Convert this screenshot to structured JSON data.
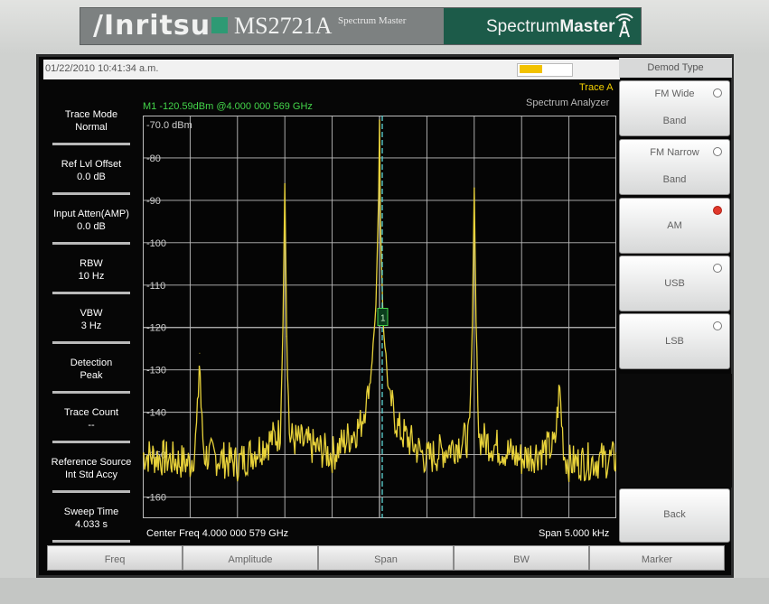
{
  "brand": {
    "logo": "/Inritsu",
    "model": "MS2721A",
    "sub": "Spectrum Master",
    "right_regular": "Spectrum",
    "right_bold": "Master"
  },
  "status": {
    "timestamp": "01/22/2010 10:41:34 a.m.",
    "battery_level": 0.45,
    "battery_color": "#f2c200"
  },
  "left_params": [
    {
      "label": "Trace Mode",
      "value": "Normal"
    },
    {
      "label": "Ref Lvl Offset",
      "value": "0.0 dB"
    },
    {
      "label": "Input Atten(AMP)",
      "value": "0.0 dB"
    },
    {
      "label": "RBW",
      "value": "10 Hz"
    },
    {
      "label": "VBW",
      "value": "3 Hz"
    },
    {
      "label": "Detection",
      "value": "Peak"
    },
    {
      "label": "Trace Count",
      "value": "--"
    },
    {
      "label": "Reference Source",
      "value": "Int Std Accy"
    },
    {
      "label": "Sweep Time",
      "value": "4.033 s"
    }
  ],
  "header": {
    "trace": "Trace A",
    "mode": "Spectrum Analyzer",
    "marker_readout": "M1 -120.59dBm @4.000 000 569 GHz"
  },
  "plot": {
    "ref_label": "-70.0 dBm",
    "y_ticks": [
      "-80",
      "-90",
      "-100",
      "-110",
      "-120",
      "-130",
      "-140",
      "-150",
      "-160"
    ],
    "marker_label": "1",
    "trace_color": "#e8d23a",
    "grid_color": "#bdbdbd",
    "marker_line_color": "#5fd6d6"
  },
  "bottom": {
    "center_freq": "Center Freq 4.000 000 579 GHz",
    "span": "Span 5.000 kHz"
  },
  "menu": [
    "Freq",
    "Amplitude",
    "Span",
    "BW",
    "Marker"
  ],
  "softkeys": {
    "title": "Demod Type",
    "items": [
      {
        "line1": "FM Wide",
        "line2": "Band",
        "selected": false
      },
      {
        "line1": "FM Narrow",
        "line2": "Band",
        "selected": false
      },
      {
        "line1": "AM",
        "line2": "",
        "selected": true
      },
      {
        "line1": "USB",
        "line2": "",
        "selected": false
      },
      {
        "line1": "LSB",
        "line2": "",
        "selected": false
      }
    ],
    "back": "Back"
  },
  "chart_data": {
    "type": "line",
    "xlabel": "Center Freq 4.000 000 579 GHz",
    "ylim": [
      -165,
      -70
    ],
    "y_ticks": [
      -80,
      -90,
      -100,
      -110,
      -120,
      -130,
      -140,
      -150,
      -160
    ],
    "series": [
      {
        "x": [
          -2.5,
          -2.0,
          -1.95,
          -1.92,
          -1.9,
          -1.88,
          -1.85,
          -1.5,
          -1.05,
          -1.02,
          -1.0,
          -0.98,
          -0.95,
          -0.5,
          -0.2,
          -0.1,
          -0.04,
          -0.01,
          0.0,
          0.01,
          0.04,
          0.1,
          0.2,
          0.5,
          0.95,
          0.98,
          1.0,
          1.02,
          1.05,
          1.5,
          1.85,
          1.88,
          1.9,
          1.92,
          1.95,
          2.0,
          2.5
        ],
        "y": [
          -150,
          -152,
          -149,
          -140,
          -126,
          -142,
          -150,
          -152,
          -145,
          -120,
          -86,
          -122,
          -146,
          -150,
          -143,
          -133,
          -116,
          -90,
          -71,
          -96,
          -120,
          -136,
          -144,
          -151,
          -146,
          -120,
          -87,
          -120,
          -146,
          -151,
          -148,
          -140,
          -133,
          -141,
          -150,
          -152,
          -151
        ]
      }
    ]
  }
}
